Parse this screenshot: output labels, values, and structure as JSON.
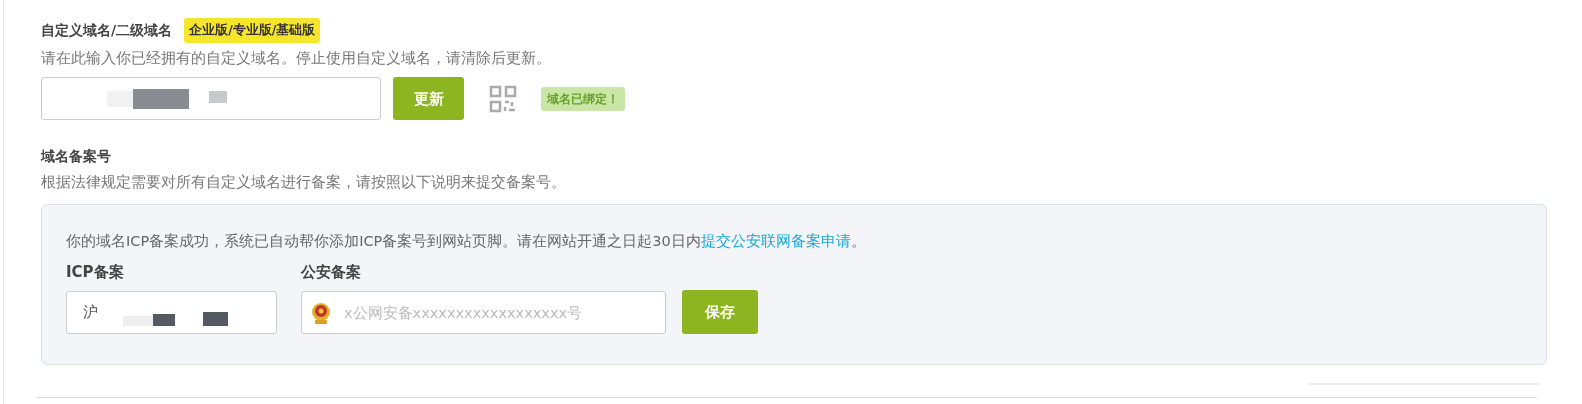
{
  "custom_domain": {
    "title": "自定义域名/二级域名",
    "plan_badge": "企业版/专业版/基础版",
    "description": "请在此输入你已经拥有的自定义域名。停止使用自定义域名，请清除后更新。",
    "update_button": "更新",
    "status_badge": "域名已绑定！"
  },
  "filing": {
    "title": "域名备案号",
    "description": "根据法律规定需要对所有自定义域名进行备案，请按照以下说明来提交备案号。",
    "notice": "你的域名ICP备案成功，系统已自动帮你添加ICP备案号到网站页脚。请在网站开通之日起30日内",
    "notice_link": "提交公安联网备案申请",
    "notice_end": "。",
    "icp_label": "ICP备案",
    "icp_value": "沪",
    "police_label": "公安备案",
    "police_placeholder": "x公网安备xxxxxxxxxxxxxxxxxx号",
    "save_button": "保存"
  }
}
